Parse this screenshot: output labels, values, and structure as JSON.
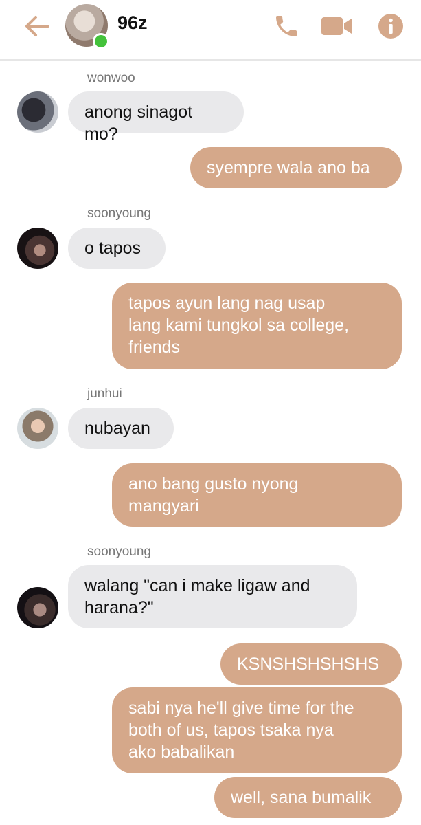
{
  "header": {
    "chat_name": "96z",
    "icons": {
      "back": "arrow-left-icon",
      "call": "phone-icon",
      "video": "video-camera-icon",
      "info": "info-icon"
    },
    "accent_color": "#d5a88a",
    "online_color": "#44c23b"
  },
  "messages": [
    {
      "sender": "wonwoo",
      "text": "anong sinagot mo?",
      "direction": "incoming"
    },
    {
      "text": "syempre wala ano ba",
      "direction": "outgoing"
    },
    {
      "sender": "soonyoung",
      "text": "o tapos",
      "direction": "incoming"
    },
    {
      "text": "tapos ayun lang nag usap\nlang kami tungkol sa college,\nfriends",
      "direction": "outgoing"
    },
    {
      "sender": "junhui",
      "text": "nubayan",
      "direction": "incoming"
    },
    {
      "text": "ano bang gusto nyong\nmangyari",
      "direction": "outgoing"
    },
    {
      "sender": "soonyoung",
      "text": "walang \"can i make ligaw and\nharana?\"",
      "direction": "incoming"
    },
    {
      "text": "KSNSHSHSHSHS",
      "direction": "outgoing"
    },
    {
      "text": "sabi nya he'll give time for the\nboth of us, tapos tsaka nya\nako babalikan",
      "direction": "outgoing"
    },
    {
      "text": "well, sana bumalik",
      "direction": "outgoing"
    }
  ],
  "colors": {
    "incoming_bubble": "#e9e9eb",
    "outgoing_bubble": "#d5a88a"
  }
}
